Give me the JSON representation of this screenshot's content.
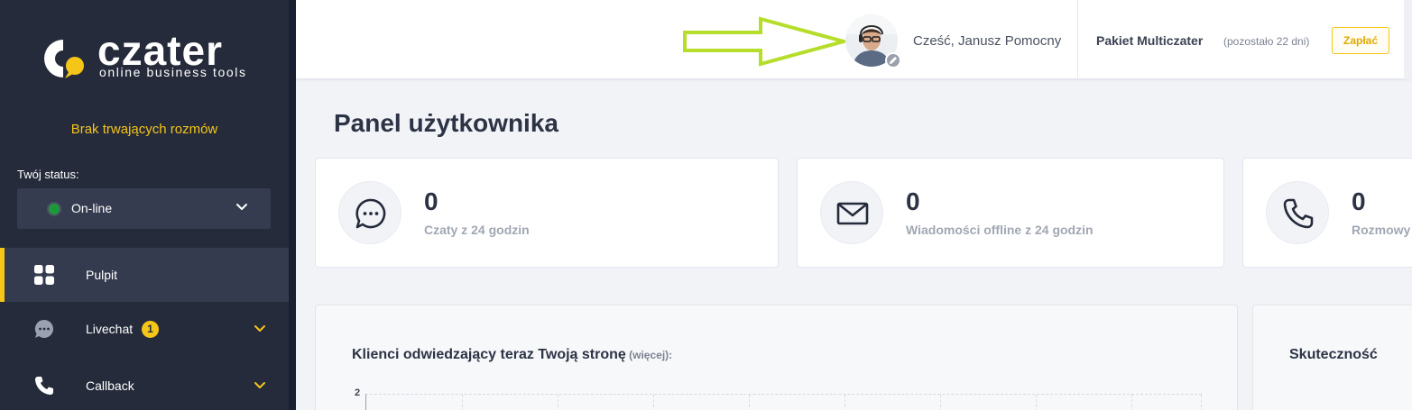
{
  "brand": {
    "name": "czater",
    "tagline": "online business tools"
  },
  "sidebar": {
    "no_chats": "Brak trwających rozmów",
    "status_label": "Twój status:",
    "status_value": "On-line",
    "items": [
      {
        "label": "Pulpit",
        "active": true
      },
      {
        "label": "Livechat",
        "badge": "1"
      },
      {
        "label": "Callback"
      }
    ]
  },
  "topbar": {
    "greeting": "Cześć, Janusz Pomocny",
    "package": "Pakiet Multiczater",
    "remaining": "(pozostało 22 dni)",
    "pay_label": "Zapłać"
  },
  "main": {
    "title": "Panel użytkownika",
    "stats": [
      {
        "value": "0",
        "label": "Czaty z 24 godzin",
        "icon": "chat-bubble-icon"
      },
      {
        "value": "0",
        "label": "Wiadomości offline z 24 godzin",
        "icon": "envelope-icon"
      },
      {
        "value": "0",
        "label": "Rozmowy",
        "icon": "phone-icon"
      }
    ],
    "visitors_title": "Klienci odwiedzający teraz Twoją stronę",
    "visitors_more_open": " (",
    "visitors_more": "więcej",
    "visitors_more_close": "):",
    "effectiveness_title": "Skuteczność",
    "axis_max": "2"
  },
  "colors": {
    "sidebar_bg": "#252b3b",
    "accent": "#f5c518",
    "online": "#1c9a3b",
    "arrow": "#b5dd2a"
  }
}
